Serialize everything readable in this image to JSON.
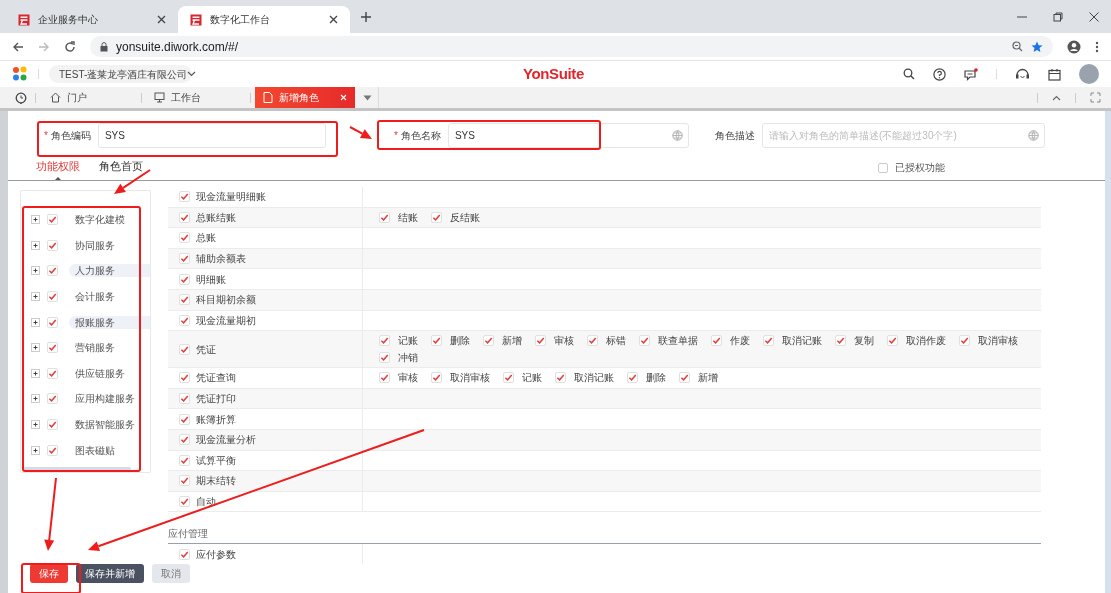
{
  "browser": {
    "tabs": [
      {
        "title": "企业服务中心",
        "selected": false
      },
      {
        "title": "数字化工作台",
        "selected": true
      }
    ],
    "url": "yonsuite.diwork.com/#/"
  },
  "app_header": {
    "company": "TEST-蓬莱龙亭酒庄有限公司",
    "brand": "YonSuite"
  },
  "app_tabs": [
    {
      "label": "门户",
      "kind": "home",
      "selected": false
    },
    {
      "label": "工作台",
      "kind": "workbench",
      "selected": false
    },
    {
      "label": "新增角色",
      "kind": "page",
      "selected": true
    }
  ],
  "form": {
    "fields": [
      {
        "label": "角色编码",
        "required_mark": "*",
        "value": "SYS"
      },
      {
        "label": "角色名称",
        "required_mark": "*",
        "value": "SYS"
      },
      {
        "label": "角色描述",
        "placeholder": "请输入对角色的简单描述(不能超过30个字)"
      }
    ]
  },
  "role_tabs": [
    {
      "label": "功能权限",
      "selected": true
    },
    {
      "label": "角色首页",
      "selected": false
    }
  ],
  "authorized_only": {
    "label": "已授权功能",
    "checked": false
  },
  "tree": [
    {
      "label": "数字化建模",
      "checked": true,
      "highlighted": false
    },
    {
      "label": "协同服务",
      "checked": true,
      "highlighted": false
    },
    {
      "label": "人力服务",
      "checked": true,
      "highlighted": true
    },
    {
      "label": "会计服务",
      "checked": true,
      "highlighted": false
    },
    {
      "label": "报账服务",
      "checked": true,
      "highlighted": true
    },
    {
      "label": "营销服务",
      "checked": true,
      "highlighted": false
    },
    {
      "label": "供应链服务",
      "checked": true,
      "highlighted": false
    },
    {
      "label": "应用构建服务",
      "checked": true,
      "highlighted": false
    },
    {
      "label": "数据智能服务",
      "checked": true,
      "highlighted": false
    },
    {
      "label": "图表磁贴",
      "checked": true,
      "highlighted": false
    }
  ],
  "permission_sections": [
    {
      "rows": [
        {
          "name": "现金流量明细账",
          "checked": true,
          "actions": []
        },
        {
          "name": "总账结账",
          "checked": true,
          "actions": [
            {
              "label": "结账",
              "checked": true
            },
            {
              "label": "反结账",
              "checked": true
            }
          ]
        },
        {
          "name": "总账",
          "checked": true,
          "actions": []
        },
        {
          "name": "辅助余额表",
          "checked": true,
          "actions": []
        },
        {
          "name": "明细账",
          "checked": true,
          "actions": []
        },
        {
          "name": "科目期初余额",
          "checked": true,
          "actions": []
        },
        {
          "name": "现金流量期初",
          "checked": true,
          "actions": []
        },
        {
          "name": "凭证",
          "checked": true,
          "actions": [
            {
              "label": "记账",
              "checked": true
            },
            {
              "label": "删除",
              "checked": true
            },
            {
              "label": "新增",
              "checked": true
            },
            {
              "label": "审核",
              "checked": true
            },
            {
              "label": "标错",
              "checked": true
            },
            {
              "label": "联查单据",
              "checked": true
            },
            {
              "label": "作废",
              "checked": true
            },
            {
              "label": "取消记账",
              "checked": true
            },
            {
              "label": "复制",
              "checked": true
            },
            {
              "label": "取消作废",
              "checked": true
            },
            {
              "label": "取消审核",
              "checked": true
            },
            {
              "label": "冲销",
              "checked": true
            }
          ]
        },
        {
          "name": "凭证查询",
          "checked": true,
          "actions": [
            {
              "label": "审核",
              "checked": true
            },
            {
              "label": "取消审核",
              "checked": true
            },
            {
              "label": "记账",
              "checked": true
            },
            {
              "label": "取消记账",
              "checked": true
            },
            {
              "label": "删除",
              "checked": true
            },
            {
              "label": "新增",
              "checked": true
            }
          ]
        },
        {
          "name": "凭证打印",
          "checked": true,
          "actions": []
        },
        {
          "name": "账簿折算",
          "checked": true,
          "actions": []
        },
        {
          "name": "现金流量分析",
          "checked": true,
          "actions": []
        },
        {
          "name": "试算平衡",
          "checked": true,
          "actions": []
        },
        {
          "name": "期末结转",
          "checked": true,
          "actions": []
        },
        {
          "name": "自动",
          "checked": true,
          "actions": []
        }
      ]
    },
    {
      "title": "应付管理",
      "rows": [
        {
          "name": "应付参数",
          "checked": true,
          "actions": []
        }
      ]
    }
  ],
  "buttons": [
    {
      "label": "保存",
      "kind": "primary"
    },
    {
      "label": "保存并新增",
      "kind": "secondary"
    },
    {
      "label": "取消",
      "kind": "default"
    }
  ]
}
